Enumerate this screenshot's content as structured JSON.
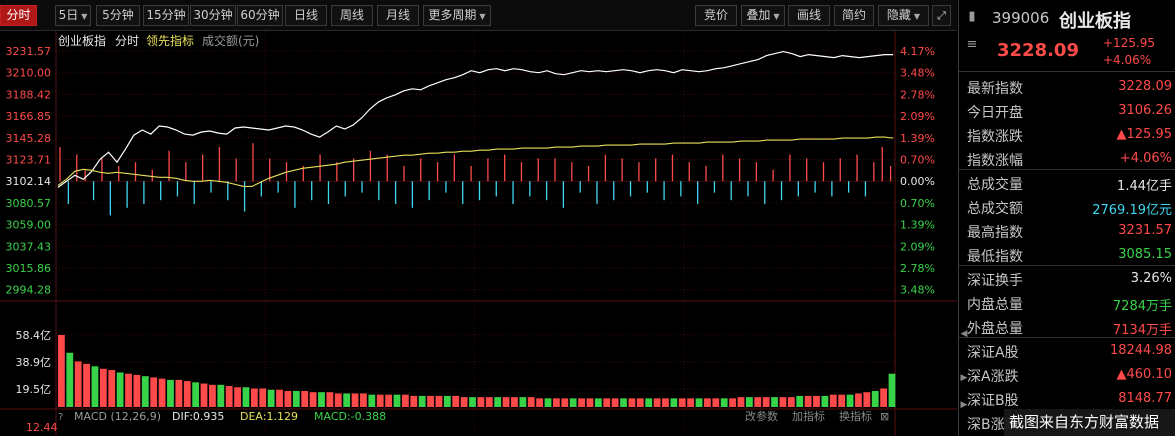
{
  "toolbar": {
    "left_buttons": [
      {
        "label": "分时",
        "active": true
      },
      {
        "label": "5日",
        "caret": true
      },
      {
        "label": "5分钟"
      },
      {
        "label": "15分钟"
      },
      {
        "label": "30分钟"
      },
      {
        "label": "60分钟"
      },
      {
        "label": "日线"
      },
      {
        "label": "周线"
      },
      {
        "label": "月线"
      },
      {
        "label": "更多周期",
        "caret": true
      }
    ],
    "right_buttons": [
      {
        "label": "竞价"
      },
      {
        "label": "叠加",
        "caret": true
      },
      {
        "label": "画线"
      },
      {
        "label": "简约"
      },
      {
        "label": "隐藏",
        "caret": true
      }
    ],
    "expand_icon": "expand-icon"
  },
  "legend": {
    "name": "创业板指",
    "mode": "分时",
    "leading": "领先指标",
    "amount": "成交额(元)"
  },
  "macd": {
    "title": "MACD (12,26,9)",
    "dif": "DIF:0.935",
    "dea": "DEA:1.129",
    "macd": "MACD:-0.388",
    "buttons": [
      "改参数",
      "加指标",
      "换指标"
    ]
  },
  "chart_data": {
    "type": "line",
    "prev_close": 3102.14,
    "y_ticks_left": [
      "3231.57",
      "3210.00",
      "3188.42",
      "3166.85",
      "3145.28",
      "3123.71",
      "3102.14",
      "3080.57",
      "3059.00",
      "3037.43",
      "3015.86",
      "2994.28"
    ],
    "y_ticks_right": [
      "4.17%",
      "3.48%",
      "2.78%",
      "2.09%",
      "1.39%",
      "0.70%",
      "0.00%",
      "0.70%",
      "1.39%",
      "2.09%",
      "2.78%",
      "3.48%"
    ],
    "ylim": [
      2994.28,
      3231.57
    ],
    "volume_ticks": [
      "58.4亿",
      "38.9亿",
      "19.5亿"
    ],
    "macd_axis_label": "12.44",
    "series": [
      {
        "name": "价格",
        "color": "#ffffff",
        "values": [
          3096,
          3102,
          3108,
          3104,
          3112,
          3124,
          3131,
          3121,
          3134,
          3148,
          3153,
          3149,
          3157,
          3156,
          3153,
          3149,
          3148,
          3151,
          3152,
          3150,
          3149,
          3155,
          3156,
          3155,
          3154,
          3153,
          3155,
          3157,
          3156,
          3153,
          3149,
          3146,
          3151,
          3157,
          3154,
          3158,
          3165,
          3174,
          3181,
          3185,
          3188,
          3192,
          3194,
          3193,
          3197,
          3200,
          3203,
          3205,
          3208,
          3212,
          3210,
          3213,
          3214,
          3212,
          3214,
          3213,
          3211,
          3210,
          3212,
          3209,
          3208,
          3210,
          3212,
          3211,
          3212,
          3211,
          3212,
          3213,
          3212,
          3210,
          3212,
          3213,
          3212,
          3210,
          3213,
          3212,
          3211,
          3212,
          3214,
          3215,
          3217,
          3219,
          3221,
          3223,
          3227,
          3229,
          3231,
          3229,
          3226,
          3228,
          3227,
          3226,
          3225,
          3227,
          3226,
          3225,
          3226,
          3227,
          3228,
          3228
        ]
      },
      {
        "name": "均价",
        "color": "#e8e05a",
        "values": [
          3098,
          3104,
          3112,
          3114,
          3113,
          3111,
          3110,
          3111,
          3110,
          3109,
          3108,
          3107,
          3106,
          3106,
          3105,
          3103,
          3102,
          3102,
          3103,
          3102,
          3101,
          3099,
          3097,
          3097,
          3101,
          3105,
          3108,
          3111,
          3113,
          3115,
          3116,
          3117,
          3118,
          3119,
          3121,
          3122,
          3123,
          3124,
          3125,
          3126,
          3127,
          3128,
          3128,
          3129,
          3130,
          3130,
          3131,
          3131,
          3132,
          3132,
          3133,
          3133,
          3134,
          3134,
          3134,
          3135,
          3135,
          3135,
          3135,
          3136,
          3136,
          3136,
          3137,
          3137,
          3137,
          3138,
          3138,
          3138,
          3138,
          3139,
          3139,
          3139,
          3139,
          3140,
          3140,
          3140,
          3140,
          3141,
          3141,
          3141,
          3141,
          3142,
          3142,
          3142,
          3143,
          3143,
          3143,
          3143,
          3144,
          3144,
          3144,
          3144,
          3144,
          3145,
          3145,
          3145,
          3145,
          3146,
          3146,
          3145
        ]
      }
    ],
    "leading_bars": [
      0.9,
      -0.6,
      0.7,
      0.3,
      -0.5,
      0.6,
      -0.9,
      0.4,
      -0.7,
      0.5,
      -0.6,
      0.3,
      -0.5,
      0.8,
      -0.4,
      0.5,
      -0.6,
      0.7,
      -0.3,
      0.9,
      -0.5,
      0.6,
      -0.8,
      1.0,
      -0.4,
      0.6,
      -0.3,
      0.5,
      -0.7,
      0.4,
      -0.5,
      0.7,
      -0.6,
      0.5,
      -0.4,
      0.6,
      -0.3,
      0.8,
      -0.5,
      0.7,
      -0.6,
      0.4,
      -0.7,
      0.6,
      -0.5,
      0.5,
      -0.3,
      0.7,
      -0.6,
      0.4,
      -0.5,
      0.6,
      -0.4,
      0.7,
      -0.6,
      0.5,
      -0.4,
      0.6,
      -0.5,
      0.6,
      -0.7,
      0.5,
      -0.3,
      0.4,
      -0.6,
      0.7,
      -0.5,
      0.6,
      -0.4,
      0.5,
      -0.3,
      0.6,
      -0.5,
      0.7,
      -0.4,
      0.5,
      -0.6,
      0.4,
      -0.3,
      0.7,
      -0.5,
      0.6,
      -0.4,
      0.5,
      -0.6,
      0.3,
      -0.5,
      0.7,
      -0.4,
      0.6,
      -0.3,
      0.5,
      -0.4,
      0.6,
      -0.3,
      0.7,
      -0.4,
      0.5,
      0.9,
      0.4
    ],
    "volume_values": [
      58.4,
      44,
      37,
      35,
      33,
      31,
      30,
      28,
      27,
      26,
      25,
      24,
      23,
      22,
      22,
      21,
      20,
      19,
      18,
      18,
      17,
      16,
      16,
      15,
      15,
      14,
      14,
      13,
      13,
      13,
      12,
      12,
      12,
      11,
      11,
      11,
      11,
      10,
      10,
      10,
      10,
      10,
      9,
      9,
      9,
      9,
      9,
      9,
      8,
      8,
      8,
      8,
      8,
      8,
      8,
      8,
      8,
      7,
      7,
      7,
      7,
      7,
      7,
      7,
      7,
      7,
      7,
      7,
      7,
      7,
      7,
      7,
      7,
      7,
      7,
      7,
      7,
      7,
      7,
      7,
      7,
      8,
      8,
      8,
      8,
      8,
      8,
      8,
      9,
      9,
      9,
      9,
      10,
      10,
      10,
      11,
      12,
      13,
      15,
      27
    ],
    "volume_max": 58.4
  },
  "panel": {
    "code": "399006",
    "name": "创业板指",
    "price": "3228.09",
    "change": "+125.95",
    "change_pct": "+4.06%",
    "rows": [
      {
        "label": "最新指数",
        "value": "3228.09",
        "color": "red"
      },
      {
        "label": "今日开盘",
        "value": "3106.26",
        "color": "red"
      },
      {
        "label": "指数涨跌",
        "value": "▲125.95",
        "color": "red"
      },
      {
        "label": "指数涨幅",
        "value": "+4.06%",
        "color": "red"
      },
      {
        "label": "总成交量",
        "value": "1.44亿手",
        "color": "white"
      },
      {
        "label": "总成交额",
        "value": "2769.19亿元",
        "color": "cyan"
      },
      {
        "label": "最高指数",
        "value": "3231.57",
        "color": "red"
      },
      {
        "label": "最低指数",
        "value": "3085.15",
        "color": "green"
      },
      {
        "label": "深证换手",
        "value": "3.26%",
        "color": "white"
      },
      {
        "label": "内盘总量",
        "value": "7284万手",
        "color": "green"
      },
      {
        "label": "外盘总量",
        "value": "7134万手",
        "color": "red"
      },
      {
        "label": "深证A股",
        "value": "18244.98",
        "color": "red"
      },
      {
        "label": "深A涨跌",
        "value": "▲460.10",
        "color": "red"
      },
      {
        "label": "深证B股",
        "value": "8148.77",
        "color": "red"
      },
      {
        "label": "深B涨跌",
        "value": "",
        "color": "red"
      }
    ]
  },
  "watermark": "截图来自东方财富数据"
}
